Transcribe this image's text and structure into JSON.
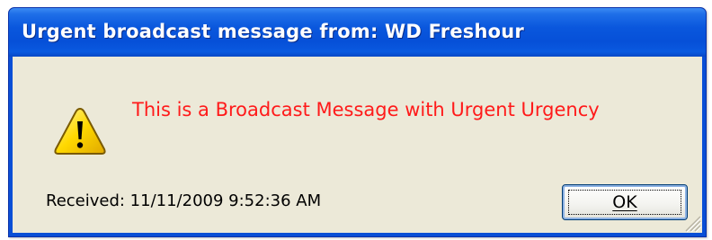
{
  "window": {
    "title": "Urgent broadcast message from: WD Freshour"
  },
  "content": {
    "icon": "warning-icon",
    "message": "This is a Broadcast Message with Urgent Urgency",
    "message_color": "#ff1a1a",
    "received_text": "Received: 11/11/2009 9:52:36 AM"
  },
  "buttons": {
    "ok_label": "OK"
  },
  "colors": {
    "titlebar": "#0a57dd",
    "client_background": "#ece9d8"
  }
}
